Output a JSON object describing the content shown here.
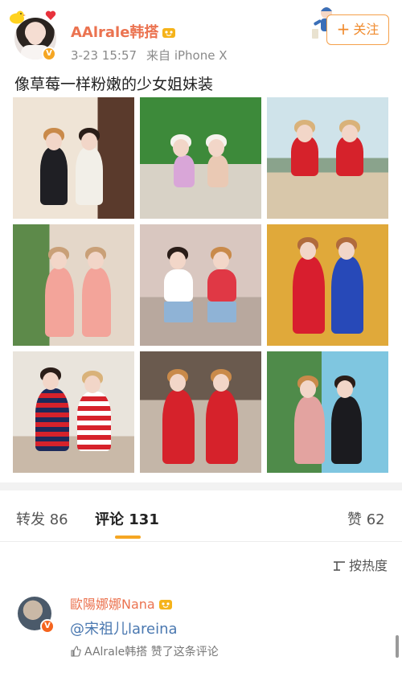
{
  "post": {
    "username": "AAlrale韩搭",
    "date": "3-23 15:57",
    "source": "来自 iPhone X",
    "follow_label": "关注",
    "text": "像草莓一样粉嫩的少女姐妹装",
    "verified_icon": "v-badge",
    "colors": {
      "username": "#eb7350",
      "follow": "#f08a2c",
      "accent": "#f5a623"
    }
  },
  "photos": [
    {
      "name": "photo-1",
      "desc_icon": "two-girls-black-white-tops"
    },
    {
      "name": "photo-2",
      "desc_icon": "two-girls-swimwear-palms"
    },
    {
      "name": "photo-3",
      "desc_icon": "two-girls-red-hoodies-bench"
    },
    {
      "name": "photo-4",
      "desc_icon": "two-girls-pink-shirts-hats"
    },
    {
      "name": "photo-5",
      "desc_icon": "two-girls-denim-shorts"
    },
    {
      "name": "photo-6",
      "desc_icon": "two-girls-red-blue-dresses"
    },
    {
      "name": "photo-7",
      "desc_icon": "two-girls-striped-sweaters"
    },
    {
      "name": "photo-8",
      "desc_icon": "two-girls-red-tops"
    },
    {
      "name": "photo-9",
      "desc_icon": "two-girls-offshoulder-dresses-pool"
    }
  ],
  "tabs": {
    "repost": "转发 86",
    "comment": "评论 131",
    "like": "赞 62"
  },
  "sort": {
    "label": "按热度"
  },
  "comment": {
    "username": "歐陽娜娜Nana",
    "text": "@宋祖儿lareina",
    "liked_by": "AAlrale韩搭 赞了这条评论"
  }
}
